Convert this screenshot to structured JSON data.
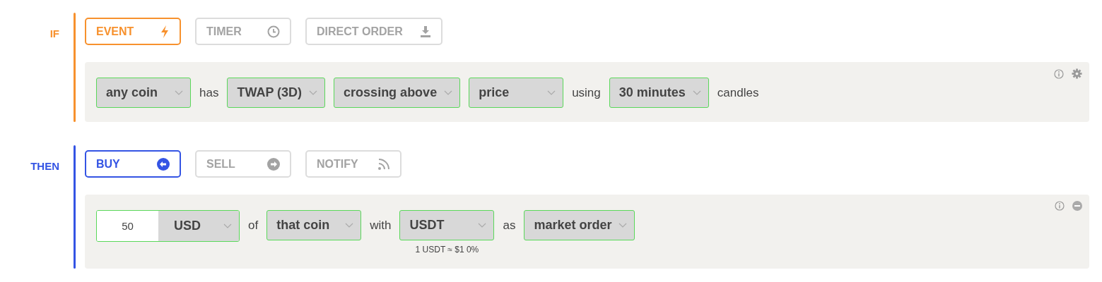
{
  "sections": [
    {
      "label": "IF",
      "kind": "if",
      "modes": [
        {
          "label": "EVENT",
          "kind": "bolt",
          "selected": true
        },
        {
          "label": "TIMER",
          "kind": "clock",
          "selected": false
        },
        {
          "label": "DIRECT ORDER",
          "kind": "download",
          "selected": false
        }
      ],
      "tokens": [
        {
          "kind": "select",
          "value": "any coin"
        },
        {
          "kind": "text",
          "value": "has"
        },
        {
          "kind": "select",
          "value": "TWAP (3D)"
        },
        {
          "kind": "select",
          "value": "crossing above"
        },
        {
          "kind": "select",
          "value": "price"
        },
        {
          "kind": "text",
          "value": "using"
        },
        {
          "kind": "select",
          "value": "30 minutes"
        },
        {
          "kind": "text",
          "value": "candles"
        }
      ]
    },
    {
      "label": "THEN",
      "kind": "then",
      "modes": [
        {
          "label": "BUY",
          "kind": "left",
          "selected": true
        },
        {
          "label": "SELL",
          "kind": "right",
          "selected": false
        },
        {
          "label": "NOTIFY",
          "kind": "feed",
          "selected": false
        }
      ],
      "tokens": [
        {
          "kind": "amount",
          "value": "50",
          "unit": "USD"
        },
        {
          "kind": "text",
          "value": "of"
        },
        {
          "kind": "select",
          "value": "that coin"
        },
        {
          "kind": "text",
          "value": "with"
        },
        {
          "kind": "select",
          "value": "USDT",
          "note": "1 USDT ≈ $1 0%"
        },
        {
          "kind": "text",
          "value": "as"
        },
        {
          "kind": "select",
          "value": "market order"
        }
      ]
    }
  ]
}
